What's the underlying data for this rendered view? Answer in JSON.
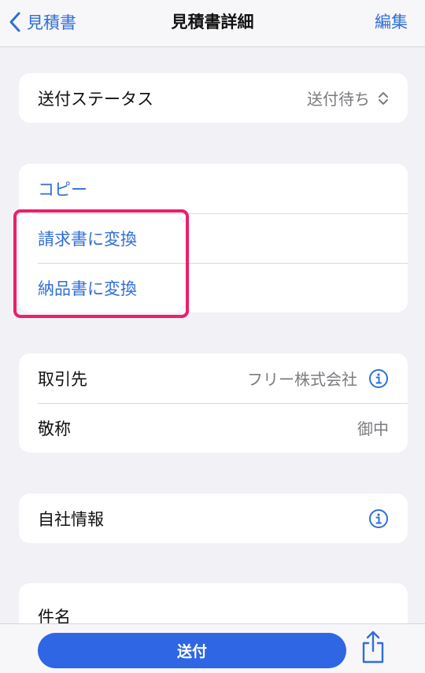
{
  "header": {
    "back_label": "見積書",
    "title": "見積書詳細",
    "edit_label": "編集"
  },
  "status_section": {
    "label": "送付ステータス",
    "value": "送付待ち"
  },
  "actions_section": {
    "copy_label": "コピー",
    "convert_invoice_label": "請求書に変換",
    "convert_delivery_label": "納品書に変換"
  },
  "client_section": {
    "client_label": "取引先",
    "client_value": "フリー株式会社",
    "honorific_label": "敬称",
    "honorific_value": "御中"
  },
  "company_section": {
    "label": "自社情報"
  },
  "subject_section": {
    "label": "件名"
  },
  "footer": {
    "send_label": "送付"
  },
  "colors": {
    "accent": "#2f6fd6",
    "send_button": "#2f66e4",
    "highlight_border": "#ec1f6a",
    "background": "#f2f1f6"
  }
}
